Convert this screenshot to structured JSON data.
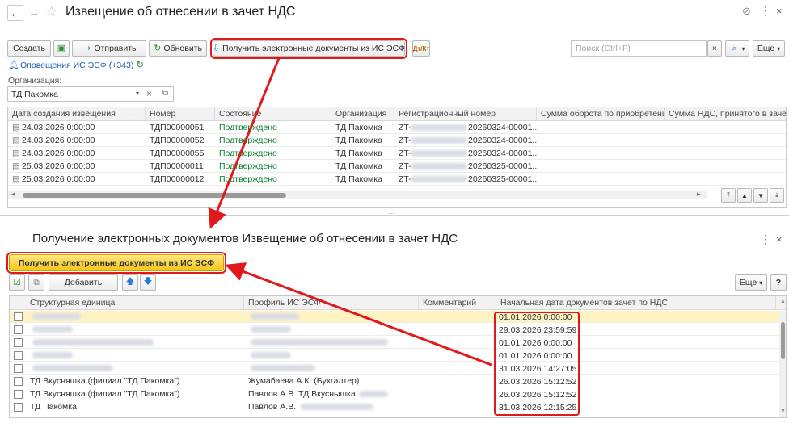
{
  "window": {
    "title": "Извещение об отнесении в зачет НДС"
  },
  "toolbar": {
    "create": "Создать",
    "send": "Отправить",
    "refresh": "Обновить",
    "get_docs": "Получить электронные документы из ИС ЭСФ",
    "dt_kt": "Дт/Кт",
    "search_placeholder": "Поиск (Ctrl+F)",
    "more": "Еще"
  },
  "notifications": {
    "label": "Оповещения ИС ЭСФ (+343)"
  },
  "org_filter": {
    "label": "Организация:",
    "value": "ТД Пакомка"
  },
  "top_table": {
    "headers": [
      "Дата создания извещения",
      "Номер",
      "Состояние",
      "Организация",
      "Регистрационный номер",
      "Сумма оборота по приобретению",
      "Сумма НДС, принятого в зачет"
    ],
    "rows": [
      {
        "date": "24.03.2026 0:00:00",
        "number": "ТДП00000051",
        "status": "Подтверждено",
        "org": "ТД Пакомка",
        "reg_prefix": "ZT-",
        "reg_suffix": "20260324-00001..."
      },
      {
        "date": "24.03.2026 0:00:00",
        "number": "ТДП00000052",
        "status": "Подтверждено",
        "org": "ТД Пакомка",
        "reg_prefix": "ZT-",
        "reg_suffix": "20260324-00001..."
      },
      {
        "date": "24.03.2026 0:00:00",
        "number": "ТДП00000055",
        "status": "Подтверждено",
        "org": "ТД Пакомка",
        "reg_prefix": "ZT-",
        "reg_suffix": "20260324-00001..."
      },
      {
        "date": "25.03.2026 0:00:00",
        "number": "ТДП00000011",
        "status": "Подтверждено",
        "org": "ТД Пакомка",
        "reg_prefix": "ZT-",
        "reg_suffix": "20260325-00001..."
      },
      {
        "date": "25.03.2026 0:00:00",
        "number": "ТДП00000012",
        "status": "Подтверждено",
        "org": "ТД Пакомка",
        "reg_prefix": "ZT-",
        "reg_suffix": "20260325-00001..."
      }
    ]
  },
  "bottom": {
    "title": "Получение электронных документов Извещение об отнесении в зачет НДС",
    "get_docs": "Получить электронные документы из ИС ЭСФ",
    "add": "Добавить",
    "more": "Еще",
    "help": "?",
    "headers": [
      "Структурная единица",
      "Профиль ИС ЭСФ",
      "Комментарий",
      "Начальная дата документов зачет по НДС"
    ],
    "rows": [
      {
        "unit": "",
        "profile": "",
        "date": "01.01.2026 0:00:00"
      },
      {
        "unit": "",
        "profile": "",
        "date": "29.03.2026 23:59:59"
      },
      {
        "unit": "",
        "profile": "",
        "date": "01.01.2026 0:00:00"
      },
      {
        "unit": "",
        "profile": "",
        "date": "01.01.2026 0:00:00"
      },
      {
        "unit": "",
        "profile": "",
        "date": "31.03.2026 14:27:05"
      },
      {
        "unit": "ТД Вкусняшка (филиал \"ТД Пакомка\")",
        "profile": "Жумабаева А.К. (Бухгалтер)",
        "date": "26.03.2026 15:12:52"
      },
      {
        "unit": "ТД Вкусняшка (филиал \"ТД Пакомка\")",
        "profile": "Павлов А.В. ТД Вкуснышка",
        "date": "26.03.2026 15:12:52"
      },
      {
        "unit": "ТД Пакомка",
        "profile": "Павлов А.В.",
        "date": "31.03.2026 12:15:25"
      }
    ]
  },
  "colors": {
    "highlight": "#e0191b",
    "accent_green": "#0a7d2c",
    "link": "#1a5fb4"
  }
}
